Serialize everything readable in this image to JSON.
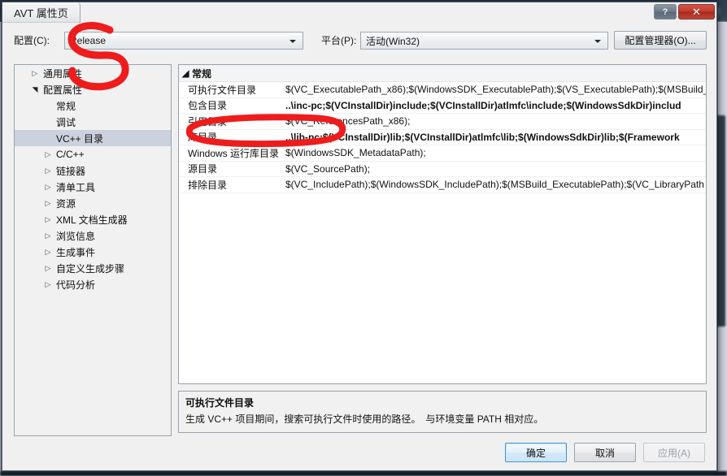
{
  "window": {
    "title": "AVT 属性页",
    "help_button": "?",
    "close_button": "✕"
  },
  "config_bar": {
    "config_label": "配置(C):",
    "config_value": "Release",
    "platform_label": "平台(P):",
    "platform_value": "活动(Win32)",
    "config_manager_button": "配置管理器(O)..."
  },
  "tree": {
    "items": [
      {
        "label": "通用属性",
        "indent": 0,
        "state": "collapsed",
        "selected": false
      },
      {
        "label": "配置属性",
        "indent": 0,
        "state": "expanded",
        "selected": false
      },
      {
        "label": "常规",
        "indent": 1,
        "state": "leaf",
        "selected": false
      },
      {
        "label": "调试",
        "indent": 1,
        "state": "leaf",
        "selected": false
      },
      {
        "label": "VC++ 目录",
        "indent": 1,
        "state": "leaf",
        "selected": true
      },
      {
        "label": "C/C++",
        "indent": 1,
        "state": "collapsed",
        "selected": false
      },
      {
        "label": "链接器",
        "indent": 1,
        "state": "collapsed",
        "selected": false
      },
      {
        "label": "清单工具",
        "indent": 1,
        "state": "collapsed",
        "selected": false
      },
      {
        "label": "资源",
        "indent": 1,
        "state": "collapsed",
        "selected": false
      },
      {
        "label": "XML 文档生成器",
        "indent": 1,
        "state": "collapsed",
        "selected": false
      },
      {
        "label": "浏览信息",
        "indent": 1,
        "state": "collapsed",
        "selected": false
      },
      {
        "label": "生成事件",
        "indent": 1,
        "state": "collapsed",
        "selected": false
      },
      {
        "label": "自定义生成步骤",
        "indent": 1,
        "state": "collapsed",
        "selected": false
      },
      {
        "label": "代码分析",
        "indent": 1,
        "state": "collapsed",
        "selected": false
      }
    ]
  },
  "properties": {
    "group_title": "常规",
    "group_state": "expanded",
    "rows": [
      {
        "name": "可执行文件目录",
        "value": "$(VC_ExecutablePath_x86);$(WindowsSDK_ExecutablePath);$(VS_ExecutablePath);$(MSBuild_",
        "modified": false
      },
      {
        "name": "包含目录",
        "value": "..\\inc-pc;$(VCInstallDir)include;$(VCInstallDir)atlmfc\\include;$(WindowsSdkDir)includ",
        "modified": true
      },
      {
        "name": "引用目录",
        "value": "$(VC_ReferencesPath_x86);",
        "modified": false
      },
      {
        "name": "库目录",
        "value": "..\\lib-pc;$(VCInstallDir)lib;$(VCInstallDir)atlmfc\\lib;$(WindowsSdkDir)lib;$(Framework",
        "modified": true
      },
      {
        "name": "Windows 运行库目录",
        "value": "$(WindowsSDK_MetadataPath);",
        "modified": false
      },
      {
        "name": "源目录",
        "value": "$(VC_SourcePath);",
        "modified": false
      },
      {
        "name": "排除目录",
        "value": "$(VC_IncludePath);$(WindowsSDK_IncludePath);$(MSBuild_ExecutablePath);$(VC_LibraryPath",
        "modified": false
      }
    ]
  },
  "description": {
    "title": "可执行文件目录",
    "body": "生成 VC++ 项目期间，搜索可执行文件时使用的路径。　与环境变量 PATH 相对应。"
  },
  "footer": {
    "ok": "确定",
    "cancel": "取消",
    "apply": "应用(A)",
    "apply_disabled": true
  },
  "annotations": {
    "color": "#ee1c1c",
    "marks": [
      {
        "name": "s-shape-mark-include-library-dirs",
        "target": "包含目录 / 库目录"
      },
      {
        "name": "ellipse-mark-windowssdk-includepath",
        "target": "$(WindowsSDK_IncludePath);"
      }
    ]
  }
}
